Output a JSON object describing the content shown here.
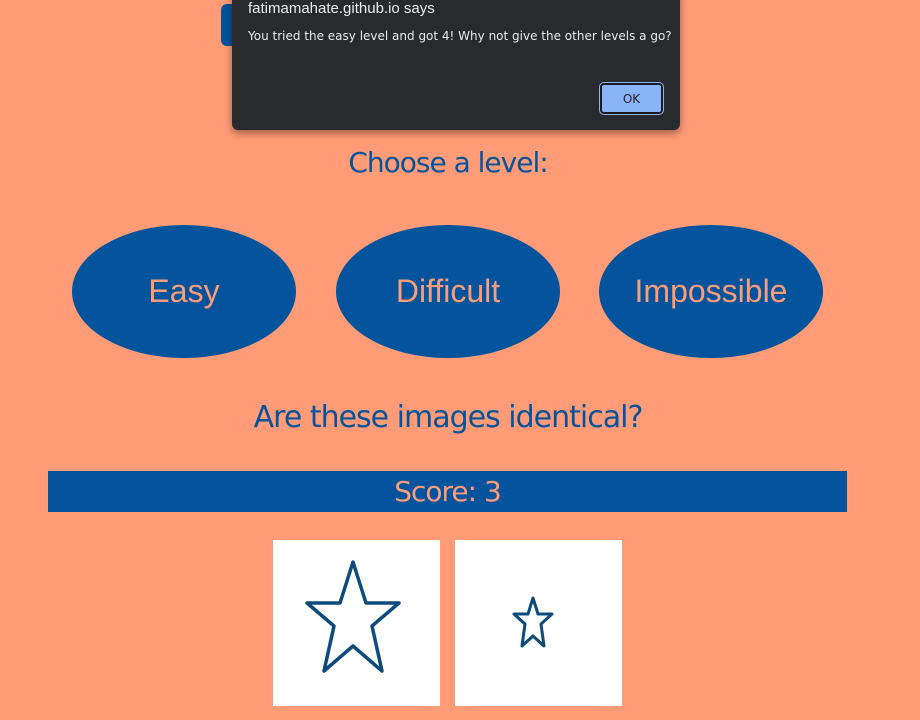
{
  "alert": {
    "title": "fatimamahate.github.io says",
    "message": "You tried the easy level and got 4! Why not give the other levels a go?",
    "ok_label": "OK"
  },
  "page": {
    "choose_heading": "Choose a level:",
    "levels": [
      {
        "label": "Easy"
      },
      {
        "label": "Difficult"
      },
      {
        "label": "Impossible"
      }
    ],
    "question": "Are these images identical?",
    "score_text": "Score: 3",
    "images": [
      {
        "icon": "star-icon"
      },
      {
        "icon": "star-icon"
      }
    ]
  },
  "colors": {
    "background": "#ff9b76",
    "primary": "#03549c",
    "dialog": "#292a2d",
    "dialog_button": "#8ab4f8"
  }
}
